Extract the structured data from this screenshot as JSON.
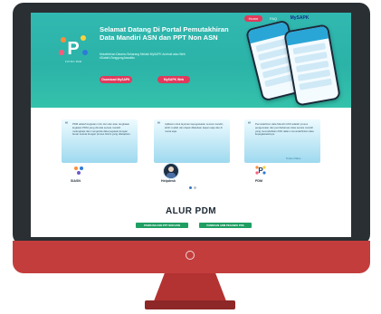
{
  "nav": {
    "home": "Home",
    "faq": "FAQ",
    "logo_text": "MySAPK"
  },
  "hero": {
    "logo_caption": "PUTIKO PDM",
    "title": "Selamat Datang Di Portal Pemutakhiran Data Mandiri ASN dan PPT Non ASN",
    "description": "Mutakhirkan Datamu Sekarang Melalui MySAPK Android atau Web #DataKuTanggungJawabku",
    "btn_download": "Download MySAPK",
    "btn_web": "MySAPK Web"
  },
  "testimonials": [
    {
      "text": "PDM adalah kegiatan rutin dan dan atau rangkaian kegiatan PDM yang dimulai secara mandiri. melengkapi dan mengelola data pegawai dengan benar sesuai dengan proses bisnis yang ditetapkan.",
      "name": "SIASN",
      "link": ""
    },
    {
      "text": "Aplikasi untuk layanan kepegawaian secara mandiri, lebih mudah dan dapat dilakukan kapan saja dan di mana saja.",
      "name": "Helpdesk",
      "link": ""
    },
    {
      "text": "Pemutakhiran data Mandiri ASN adalah proses pengecekan dan pembaharuan data secara mandiri yang memudahkan ASN dalam memutakhirkan data kepegawaiannya.",
      "name": "PDM",
      "link": "Tonton Video"
    }
  ],
  "alur": {
    "title": "ALUR PDM",
    "tab_1": "PANDUAN ASN PPT NON ASN",
    "tab_2": "PANDUAN ADM PEGAWAI PNS"
  },
  "colors": {
    "hero": "#2bb3a8",
    "accent": "#e03a5d",
    "green": "#1f9e62",
    "frame": "#2a2f33",
    "chin": "#c43d3d"
  },
  "icons": [
    "quote-icon",
    "power-icon",
    "logo-icon"
  ]
}
